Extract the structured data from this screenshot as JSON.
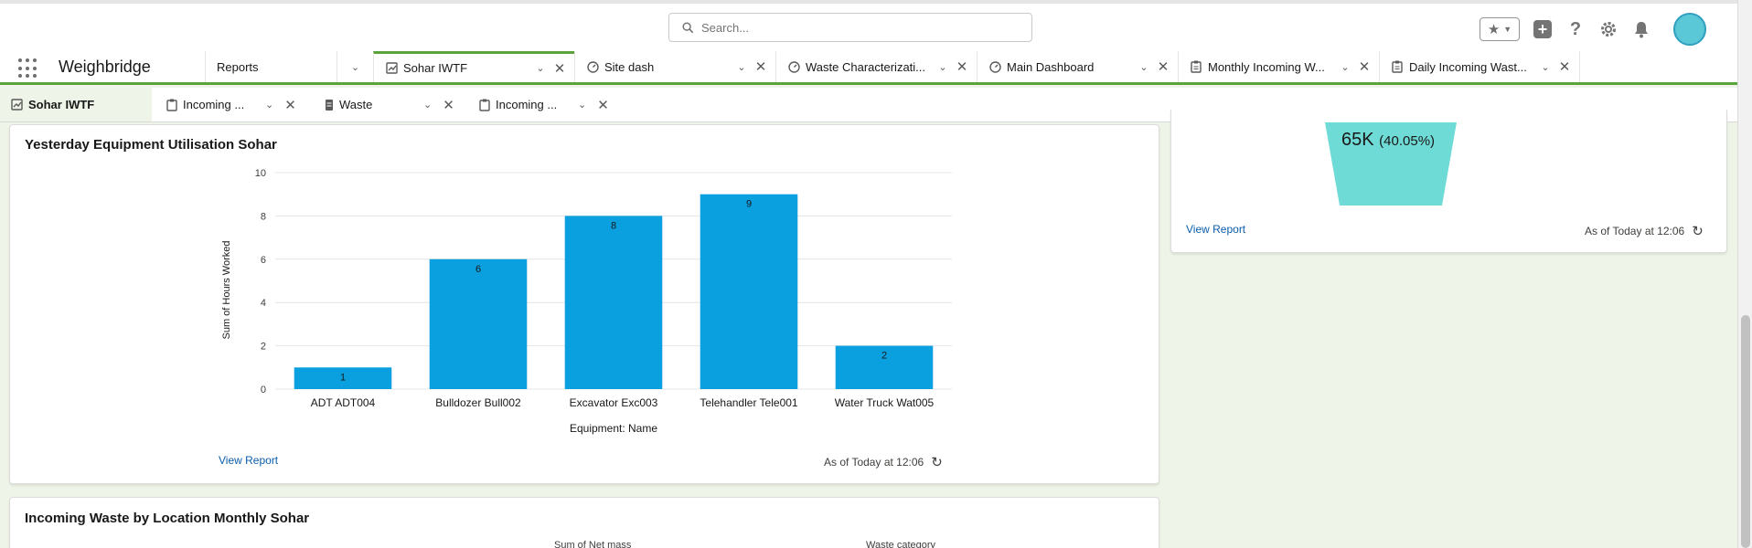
{
  "header": {
    "search_placeholder": "Search...",
    "icons": [
      "favorites-star-icon",
      "add-icon",
      "help-icon",
      "setup-gear-icon",
      "bell-icon",
      "avatar"
    ]
  },
  "app": {
    "name": "Weighbridge",
    "nav_tabs": [
      {
        "label": "Reports",
        "icon": "",
        "closable": false
      },
      {
        "label": "Sohar IWTF",
        "icon": "dashboard-icon",
        "active": true
      },
      {
        "label": "Site dash",
        "icon": "gauge-icon"
      },
      {
        "label": "Waste Characterizati...",
        "icon": "gauge-icon"
      },
      {
        "label": "Main Dashboard",
        "icon": "gauge-icon"
      },
      {
        "label": "Monthly Incoming W...",
        "icon": "report-icon"
      },
      {
        "label": "Daily Incoming Wast...",
        "icon": "report-icon"
      }
    ]
  },
  "subtabs": [
    {
      "label": "Sohar IWTF",
      "icon": "dashboard-icon",
      "current": true
    },
    {
      "label": "Incoming ...",
      "icon": "report-icon"
    },
    {
      "label": "Waste",
      "icon": "record-icon"
    },
    {
      "label": "Incoming ...",
      "icon": "report-icon"
    }
  ],
  "funnel_card": {
    "value_label": "65K",
    "percent_label": "(40.05%)",
    "view_report": "View Report",
    "as_of": "As of Today at 12:06",
    "funnel_color": "#6fdbd6"
  },
  "chart_card": {
    "title": "Yesterday Equipment Utilisation Sohar",
    "view_report": "View Report",
    "as_of": "As of Today at 12:06"
  },
  "bottom_card": {
    "title": "Incoming Waste by Location Monthly Sohar",
    "col_left": "Sum of Net mass",
    "col_right": "Waste category"
  },
  "chart_data": {
    "type": "bar",
    "categories": [
      "ADT ADT004",
      "Bulldozer Bull002",
      "Excavator Exc003",
      "Telehandler Tele001",
      "Water Truck Wat005"
    ],
    "values": [
      1,
      6,
      8,
      9,
      2
    ],
    "xlabel": "Equipment: Name",
    "ylabel": "Sum of Hours Worked",
    "ylim": [
      0,
      10
    ],
    "yticks": [
      0,
      2,
      4,
      6,
      8,
      10
    ],
    "grid": true,
    "bar_color": "#0aa0e0"
  }
}
